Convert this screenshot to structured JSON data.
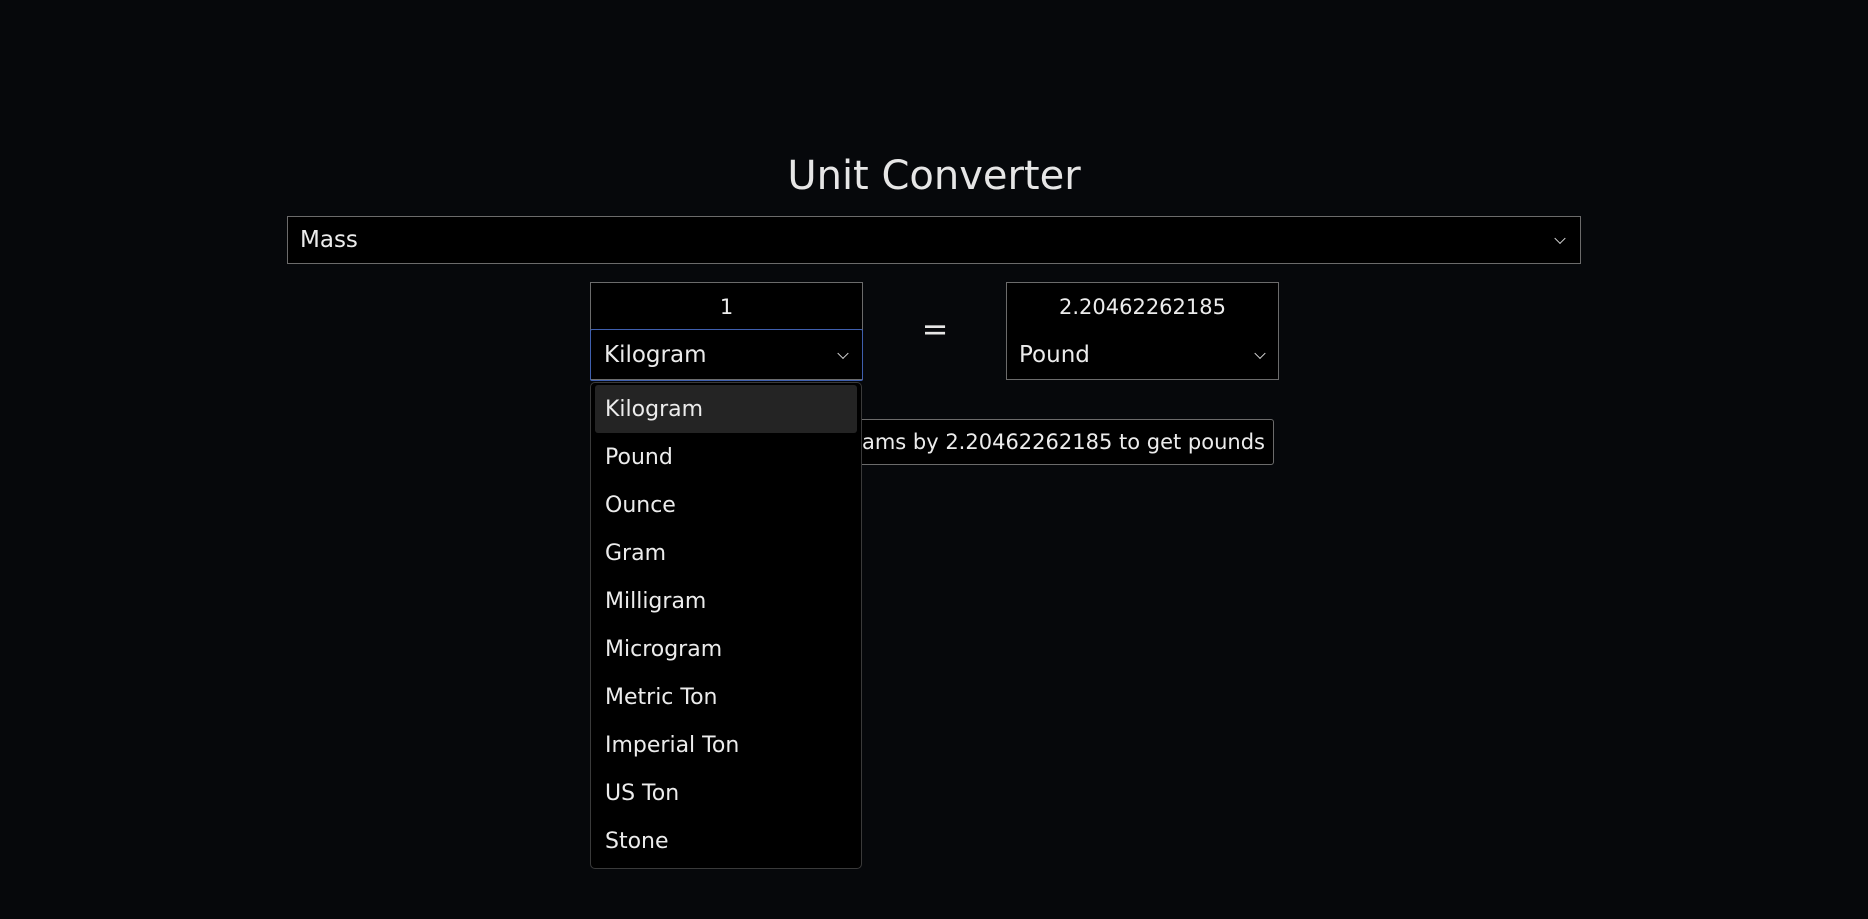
{
  "title": "Unit Converter",
  "category": {
    "selected": "Mass"
  },
  "from": {
    "value": "1",
    "unit": "Kilogram"
  },
  "equals_sign": "=",
  "to": {
    "value": "2.20462262185",
    "unit": "Pound"
  },
  "formula": {
    "visible_text": "rams by 2.20462262185 to get pounds"
  },
  "dropdown": {
    "options": [
      "Kilogram",
      "Pound",
      "Ounce",
      "Gram",
      "Milligram",
      "Microgram",
      "Metric Ton",
      "Imperial Ton",
      "US Ton",
      "Stone"
    ],
    "selected_index": 0
  },
  "colors": {
    "background": "#06080b",
    "focus_border": "#3f5fae",
    "highlight": "#242424"
  }
}
